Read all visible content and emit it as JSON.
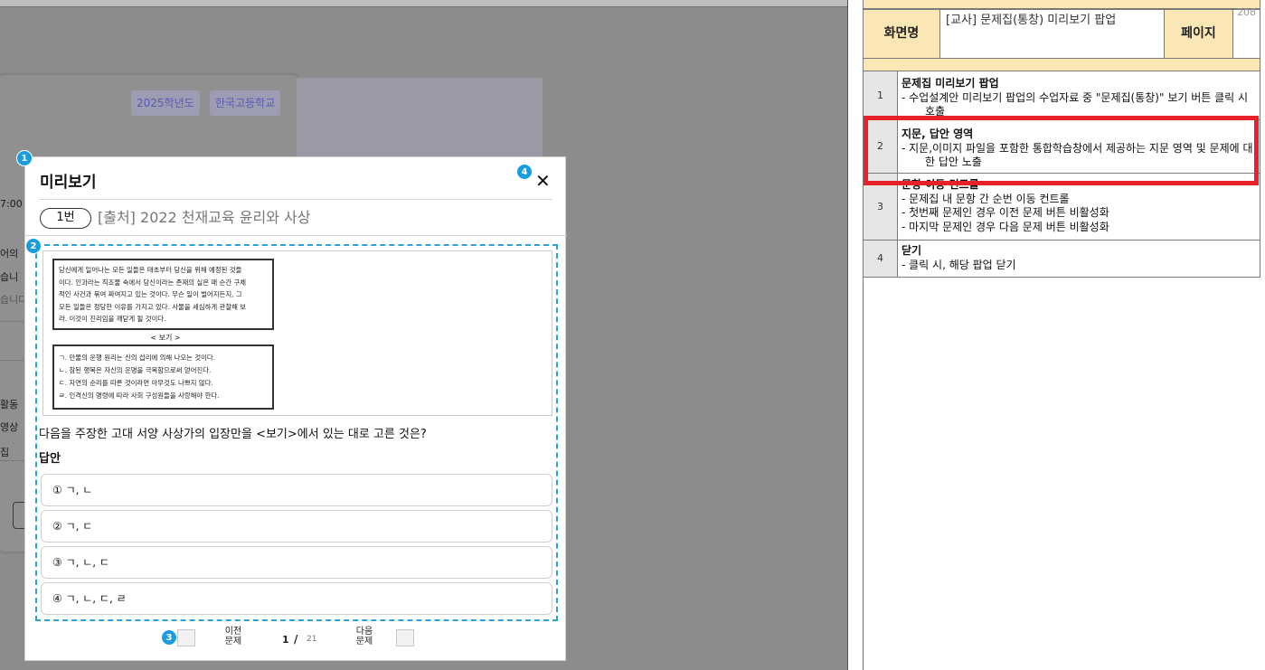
{
  "background_app": {
    "year_tag": "2025학년도",
    "school_tag": "한국고등학교",
    "fragments": [
      "7:00",
      "어의",
      "습니",
      "습니다",
      "활동",
      "영상",
      "집"
    ]
  },
  "modal": {
    "title": "미리보기",
    "close_glyph": "✕",
    "question_number": "1번",
    "source": "[출처] 2022 천재교육 윤리와 사상",
    "passage_lines": [
      "당신에게 일어나는 모든 일들은 태초부터 당신을 위해 예정된 것들",
      "이다. 인과라는 직조물 속에서 당신이라는 존재의 실은 매 순간 구체",
      "적인 사건과 묶여 짜여지고 있는 것이다. 무슨 일이 벌어지든지, 그",
      "모든 일들은 정당한 이유를 가지고 있다. 사물을 세심하게 관찰해 보",
      "라. 이것이 진리임을 깨닫게 될 것이다."
    ],
    "bogi_title": "< 보기 >",
    "bogi_items": [
      "ㄱ. 만물의 운행 원리는 신의 섭리에 의해 나오는 것이다.",
      "ㄴ. 참된 행복은 자신의 운명을 극복함으로써 얻어진다.",
      "ㄷ. 자연의 순리를 따른 것이라면 아무것도 나쁘지 않다.",
      "ㄹ. 인격신의 명령에 따라 사회 구성원들을 사랑해야 한다."
    ],
    "question": "다음을 주장한 고대 서양 사상가의 입장만을 <보기>에서 있는 대로 고른 것은?",
    "answer_label": "답안",
    "choices": [
      "① ㄱ, ㄴ",
      "② ㄱ, ㄷ",
      "③ ㄱ, ㄴ, ㄷ",
      "④ ㄱ, ㄴ, ㄷ, ㄹ"
    ],
    "pager": {
      "prev_label": "이전\n문제",
      "next_label": "다음\n문제",
      "current": "1",
      "separator": "/",
      "total": "21"
    },
    "markers": [
      "1",
      "2",
      "3",
      "4"
    ]
  },
  "spec_doc": {
    "page_number": "208",
    "screen_name_label": "화면명",
    "screen_name": "[교사] 문제집(통창) 미리보기 팝업",
    "page_label": "페이지",
    "rows": [
      {
        "number": "1",
        "heading": "문제집 미리보기 팝업",
        "bullets": [
          "-      수업설계안 미리보기 팝업의 수업자료 중 \"문제집(통창)\" 보기 버튼 클릭 시 호출"
        ]
      },
      {
        "number": "2",
        "heading": "지문, 답안 영역",
        "bullets": [
          "-      지문,이미지 파일을 포함한 통합학습창에서 제공하는 지문 영역 및 문제에 대한 답안 노출"
        ]
      },
      {
        "number": "3",
        "heading": "문항 이동 컨트롤",
        "bullets": [
          "-      문제집 내 문항 간 순번 이동 컨트롤",
          "-      첫번째 문제인 경우 이전 문제 버튼 비활성화",
          "-      마지막 문제인 경우 다음 문제 버튼 비활성화"
        ]
      },
      {
        "number": "4",
        "heading": "닫기",
        "bullets": [
          "-      클릭 시, 해당 팝업 닫기"
        ]
      }
    ],
    "highlight_color": "#e8202a"
  }
}
